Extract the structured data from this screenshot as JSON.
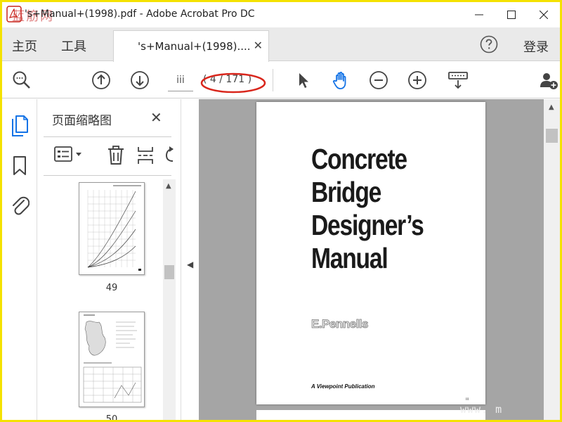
{
  "window": {
    "logo_text": "蓝筋网",
    "title": "'s+Manual+(1998).pdf - Adobe Acrobat Pro DC",
    "minimize": "minimize",
    "maximize": "maximize",
    "close": "close"
  },
  "tabs": {
    "home": "主页",
    "tools": "工具",
    "document": "'s+Manual+(1998)....",
    "document_close": "✕",
    "login": "登录"
  },
  "toolbar": {
    "page_label": "iii",
    "page_count": "( 4 / 171 )",
    "highlight_color": "#d9261c"
  },
  "thumbnails": {
    "title": "页面缩略图",
    "close": "✕",
    "items": [
      {
        "page": "49"
      },
      {
        "page": "50"
      }
    ]
  },
  "page": {
    "title_lines": [
      "Concrete",
      "Bridge",
      "Designer’s",
      "Manual"
    ],
    "author": "E.Pennells",
    "publisher": "A Viewpoint Publication",
    "corner": "iii",
    "watermark": "www.      m"
  },
  "colors": {
    "frame": "#f4e200",
    "accent": "#1473e6",
    "doc_bg": "#a5a5a5"
  }
}
